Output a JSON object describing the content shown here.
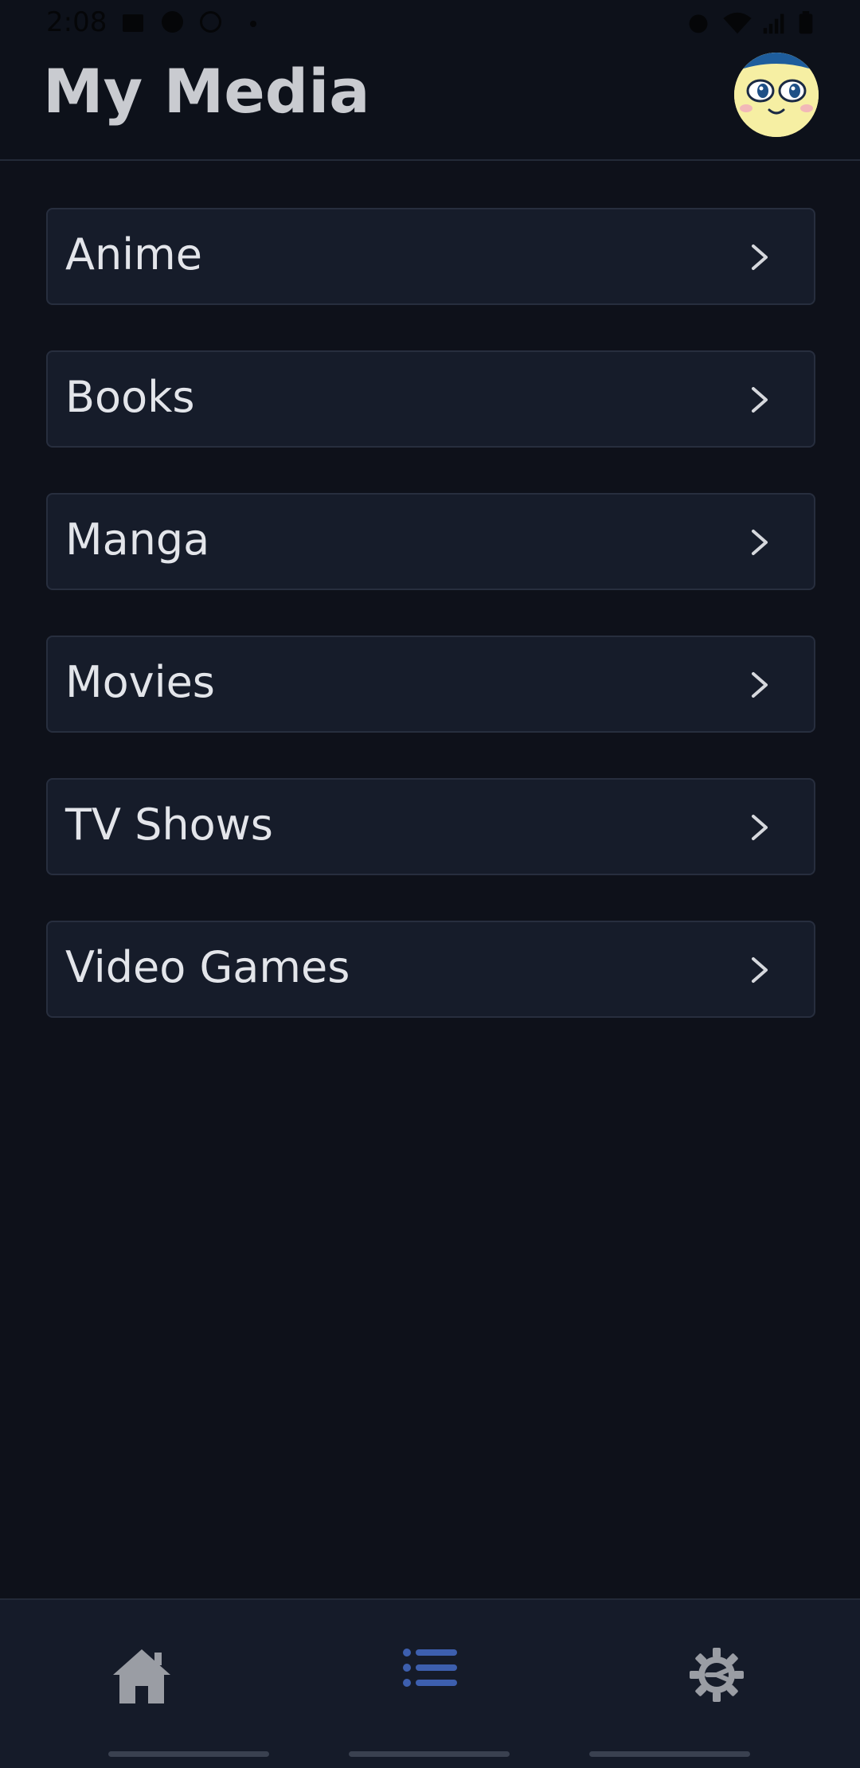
{
  "status_bar": {
    "time": "2:08"
  },
  "header": {
    "title": "My Media"
  },
  "colors": {
    "background": "#0e111a",
    "card": "#161c2a",
    "active_nav": "#3d5fae",
    "inactive_nav": "#9a9da4"
  },
  "media_categories": [
    {
      "label": "Anime"
    },
    {
      "label": "Books"
    },
    {
      "label": "Manga"
    },
    {
      "label": "Movies"
    },
    {
      "label": "TV Shows"
    },
    {
      "label": "Video Games"
    }
  ],
  "bottom_nav": {
    "items": [
      {
        "icon": "home-icon",
        "active": false
      },
      {
        "icon": "list-icon",
        "active": true
      },
      {
        "icon": "settings-gear-icon",
        "active": false
      }
    ]
  }
}
